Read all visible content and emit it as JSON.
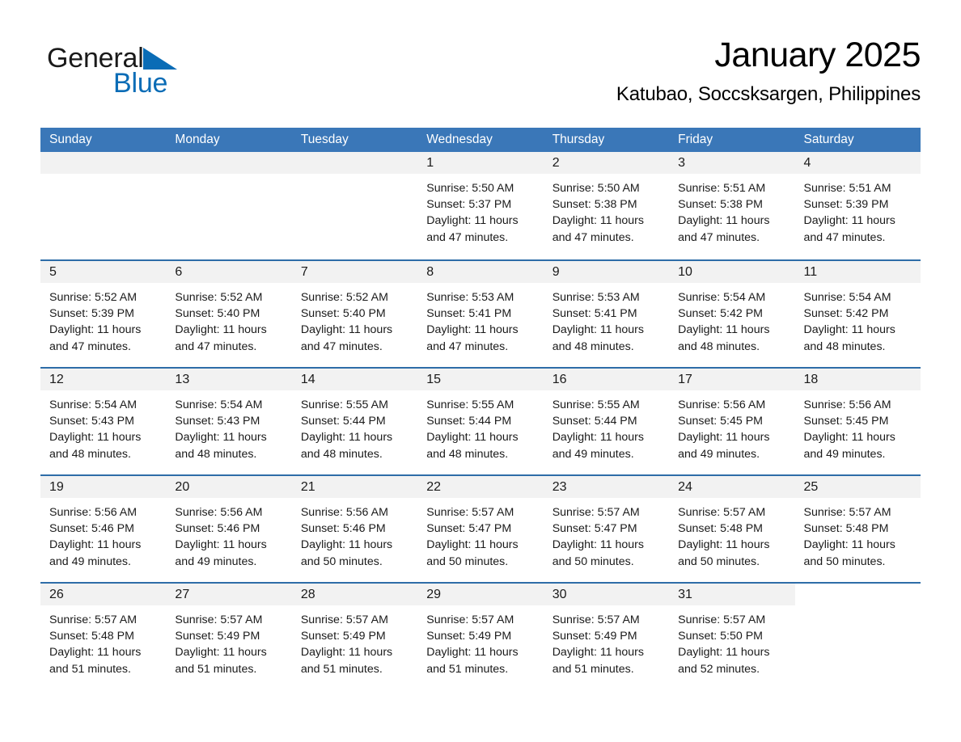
{
  "brand": {
    "name_part1": "General",
    "name_part2": "Blue",
    "accent_color": "#0a6cb6"
  },
  "header": {
    "title": "January 2025",
    "subtitle": "Katubao, Soccsksargen, Philippines"
  },
  "theme": {
    "header_blue": "#3A77B8",
    "row_divider_blue": "#2E6DA8",
    "day_band_gray": "#F2F2F2"
  },
  "weekdays": [
    "Sunday",
    "Monday",
    "Tuesday",
    "Wednesday",
    "Thursday",
    "Friday",
    "Saturday"
  ],
  "weeks": [
    [
      {
        "day": "",
        "sunrise": "",
        "sunset": "",
        "daylight1": "",
        "daylight2": "",
        "empty": true
      },
      {
        "day": "",
        "sunrise": "",
        "sunset": "",
        "daylight1": "",
        "daylight2": "",
        "empty": true
      },
      {
        "day": "",
        "sunrise": "",
        "sunset": "",
        "daylight1": "",
        "daylight2": "",
        "empty": true
      },
      {
        "day": "1",
        "sunrise": "Sunrise: 5:50 AM",
        "sunset": "Sunset: 5:37 PM",
        "daylight1": "Daylight: 11 hours",
        "daylight2": "and 47 minutes."
      },
      {
        "day": "2",
        "sunrise": "Sunrise: 5:50 AM",
        "sunset": "Sunset: 5:38 PM",
        "daylight1": "Daylight: 11 hours",
        "daylight2": "and 47 minutes."
      },
      {
        "day": "3",
        "sunrise": "Sunrise: 5:51 AM",
        "sunset": "Sunset: 5:38 PM",
        "daylight1": "Daylight: 11 hours",
        "daylight2": "and 47 minutes."
      },
      {
        "day": "4",
        "sunrise": "Sunrise: 5:51 AM",
        "sunset": "Sunset: 5:39 PM",
        "daylight1": "Daylight: 11 hours",
        "daylight2": "and 47 minutes."
      }
    ],
    [
      {
        "day": "5",
        "sunrise": "Sunrise: 5:52 AM",
        "sunset": "Sunset: 5:39 PM",
        "daylight1": "Daylight: 11 hours",
        "daylight2": "and 47 minutes."
      },
      {
        "day": "6",
        "sunrise": "Sunrise: 5:52 AM",
        "sunset": "Sunset: 5:40 PM",
        "daylight1": "Daylight: 11 hours",
        "daylight2": "and 47 minutes."
      },
      {
        "day": "7",
        "sunrise": "Sunrise: 5:52 AM",
        "sunset": "Sunset: 5:40 PM",
        "daylight1": "Daylight: 11 hours",
        "daylight2": "and 47 minutes."
      },
      {
        "day": "8",
        "sunrise": "Sunrise: 5:53 AM",
        "sunset": "Sunset: 5:41 PM",
        "daylight1": "Daylight: 11 hours",
        "daylight2": "and 47 minutes."
      },
      {
        "day": "9",
        "sunrise": "Sunrise: 5:53 AM",
        "sunset": "Sunset: 5:41 PM",
        "daylight1": "Daylight: 11 hours",
        "daylight2": "and 48 minutes."
      },
      {
        "day": "10",
        "sunrise": "Sunrise: 5:54 AM",
        "sunset": "Sunset: 5:42 PM",
        "daylight1": "Daylight: 11 hours",
        "daylight2": "and 48 minutes."
      },
      {
        "day": "11",
        "sunrise": "Sunrise: 5:54 AM",
        "sunset": "Sunset: 5:42 PM",
        "daylight1": "Daylight: 11 hours",
        "daylight2": "and 48 minutes."
      }
    ],
    [
      {
        "day": "12",
        "sunrise": "Sunrise: 5:54 AM",
        "sunset": "Sunset: 5:43 PM",
        "daylight1": "Daylight: 11 hours",
        "daylight2": "and 48 minutes."
      },
      {
        "day": "13",
        "sunrise": "Sunrise: 5:54 AM",
        "sunset": "Sunset: 5:43 PM",
        "daylight1": "Daylight: 11 hours",
        "daylight2": "and 48 minutes."
      },
      {
        "day": "14",
        "sunrise": "Sunrise: 5:55 AM",
        "sunset": "Sunset: 5:44 PM",
        "daylight1": "Daylight: 11 hours",
        "daylight2": "and 48 minutes."
      },
      {
        "day": "15",
        "sunrise": "Sunrise: 5:55 AM",
        "sunset": "Sunset: 5:44 PM",
        "daylight1": "Daylight: 11 hours",
        "daylight2": "and 48 minutes."
      },
      {
        "day": "16",
        "sunrise": "Sunrise: 5:55 AM",
        "sunset": "Sunset: 5:44 PM",
        "daylight1": "Daylight: 11 hours",
        "daylight2": "and 49 minutes."
      },
      {
        "day": "17",
        "sunrise": "Sunrise: 5:56 AM",
        "sunset": "Sunset: 5:45 PM",
        "daylight1": "Daylight: 11 hours",
        "daylight2": "and 49 minutes."
      },
      {
        "day": "18",
        "sunrise": "Sunrise: 5:56 AM",
        "sunset": "Sunset: 5:45 PM",
        "daylight1": "Daylight: 11 hours",
        "daylight2": "and 49 minutes."
      }
    ],
    [
      {
        "day": "19",
        "sunrise": "Sunrise: 5:56 AM",
        "sunset": "Sunset: 5:46 PM",
        "daylight1": "Daylight: 11 hours",
        "daylight2": "and 49 minutes."
      },
      {
        "day": "20",
        "sunrise": "Sunrise: 5:56 AM",
        "sunset": "Sunset: 5:46 PM",
        "daylight1": "Daylight: 11 hours",
        "daylight2": "and 49 minutes."
      },
      {
        "day": "21",
        "sunrise": "Sunrise: 5:56 AM",
        "sunset": "Sunset: 5:46 PM",
        "daylight1": "Daylight: 11 hours",
        "daylight2": "and 50 minutes."
      },
      {
        "day": "22",
        "sunrise": "Sunrise: 5:57 AM",
        "sunset": "Sunset: 5:47 PM",
        "daylight1": "Daylight: 11 hours",
        "daylight2": "and 50 minutes."
      },
      {
        "day": "23",
        "sunrise": "Sunrise: 5:57 AM",
        "sunset": "Sunset: 5:47 PM",
        "daylight1": "Daylight: 11 hours",
        "daylight2": "and 50 minutes."
      },
      {
        "day": "24",
        "sunrise": "Sunrise: 5:57 AM",
        "sunset": "Sunset: 5:48 PM",
        "daylight1": "Daylight: 11 hours",
        "daylight2": "and 50 minutes."
      },
      {
        "day": "25",
        "sunrise": "Sunrise: 5:57 AM",
        "sunset": "Sunset: 5:48 PM",
        "daylight1": "Daylight: 11 hours",
        "daylight2": "and 50 minutes."
      }
    ],
    [
      {
        "day": "26",
        "sunrise": "Sunrise: 5:57 AM",
        "sunset": "Sunset: 5:48 PM",
        "daylight1": "Daylight: 11 hours",
        "daylight2": "and 51 minutes."
      },
      {
        "day": "27",
        "sunrise": "Sunrise: 5:57 AM",
        "sunset": "Sunset: 5:49 PM",
        "daylight1": "Daylight: 11 hours",
        "daylight2": "and 51 minutes."
      },
      {
        "day": "28",
        "sunrise": "Sunrise: 5:57 AM",
        "sunset": "Sunset: 5:49 PM",
        "daylight1": "Daylight: 11 hours",
        "daylight2": "and 51 minutes."
      },
      {
        "day": "29",
        "sunrise": "Sunrise: 5:57 AM",
        "sunset": "Sunset: 5:49 PM",
        "daylight1": "Daylight: 11 hours",
        "daylight2": "and 51 minutes."
      },
      {
        "day": "30",
        "sunrise": "Sunrise: 5:57 AM",
        "sunset": "Sunset: 5:49 PM",
        "daylight1": "Daylight: 11 hours",
        "daylight2": "and 51 minutes."
      },
      {
        "day": "31",
        "sunrise": "Sunrise: 5:57 AM",
        "sunset": "Sunset: 5:50 PM",
        "daylight1": "Daylight: 11 hours",
        "daylight2": "and 52 minutes."
      },
      {
        "day": "",
        "sunrise": "",
        "sunset": "",
        "daylight1": "",
        "daylight2": "",
        "empty": true,
        "noband": true
      }
    ]
  ]
}
